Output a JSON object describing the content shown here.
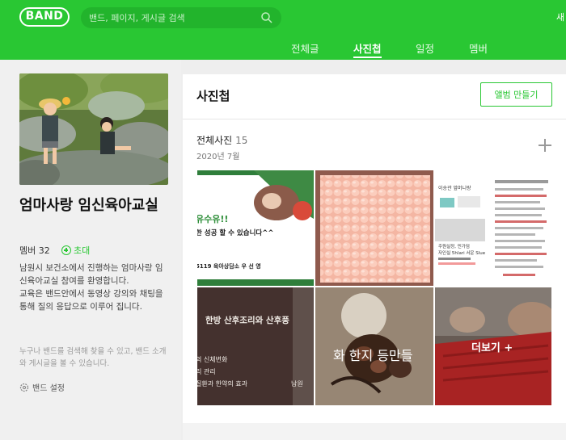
{
  "header": {
    "logo": "BAND",
    "search_placeholder": "밴드, 페이지, 게시글 검색",
    "top_right_fragment": "새",
    "nav": [
      {
        "label": "전체글"
      },
      {
        "label": "사진첩"
      },
      {
        "label": "일정"
      },
      {
        "label": "멤버"
      }
    ]
  },
  "band": {
    "name": "엄마사랑 임신육아교실",
    "members_label": "멤버 32",
    "invite_label": "초대",
    "description": [
      "남원시 보건소에서 진행하는 엄마사랑 임신육아교실 참여를 환영합니다.",
      "교육은 밴드안에서 동영상 강의와 채팅을 통해 질의 응답으로 이루어 집니다."
    ],
    "notice": "누구나 밴드를 검색해 찾을 수 있고, 밴드 소개와 게시글을 볼 수 있습니다.",
    "settings_label": "밴드 설정"
  },
  "album": {
    "title": "사진첩",
    "create_button": "앨범 만들기",
    "section_title": "전체사진",
    "photo_count": "15",
    "date": "2020년 7월",
    "more_label": "더보기 +"
  },
  "photos": {
    "p1": {
      "line1": "유수유!!",
      "line2": "한 성공 할 수 있습니다^^",
      "line3": "5119 육아상담소  우 선 영"
    },
    "p3": {
      "title": "이송관 앞머니랑",
      "item1": "주원실정, 민가덤",
      "item2": "자인실 5hlari 서운 Slue"
    },
    "p4": {
      "title": "한방 산후조리와 산후풍",
      "line1": "의 신체변화",
      "line2": "리 관리",
      "line3": "질환과 한약의 효과",
      "right": "남원"
    },
    "p5": {
      "text": "화 한지 등만들"
    }
  },
  "colors": {
    "brand_green": "#29c733",
    "search_green": "#22b42c"
  }
}
